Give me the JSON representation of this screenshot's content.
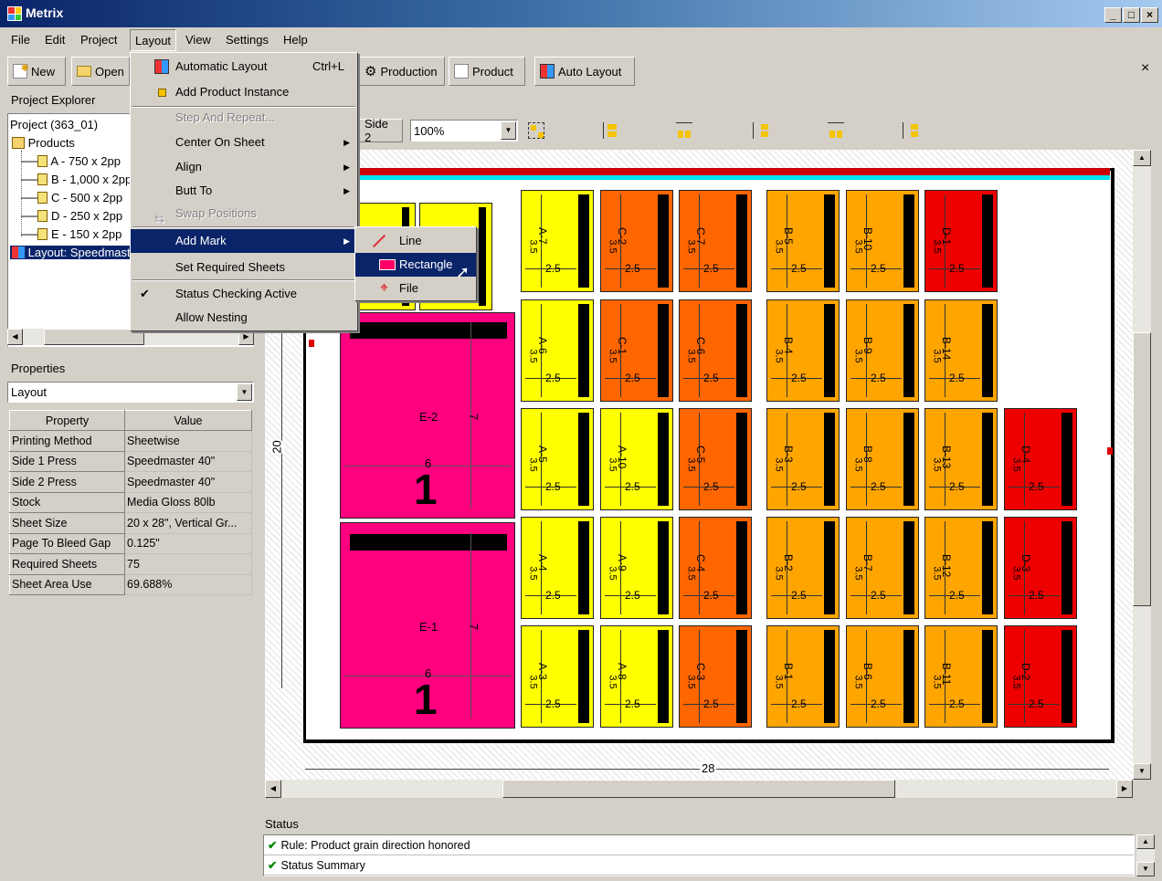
{
  "window": {
    "title": "Metrix",
    "minimize": "_",
    "maximize": "□",
    "close": "×"
  },
  "menubar": [
    "File",
    "Edit",
    "Project",
    "Layout",
    "View",
    "Settings",
    "Help"
  ],
  "toolbar": {
    "new": "New",
    "open": "Open",
    "production": "Production",
    "product": "Product",
    "auto_layout": "Auto Layout",
    "close": "×"
  },
  "project_explorer": {
    "title": "Project Explorer",
    "project": "Project  (363_01)",
    "products": "Products",
    "items": [
      "A - 750 x 2pp",
      "B - 1,000 x 2pp",
      "C - 500 x 2pp",
      "D - 250 x 2pp",
      "E - 150 x 2pp"
    ],
    "layout": "Layout: Speedmaster"
  },
  "properties": {
    "title": "Properties",
    "selector": "Layout",
    "col_property": "Property",
    "col_value": "Value",
    "rows": [
      {
        "k": "Printing Method",
        "v": "Sheetwise"
      },
      {
        "k": "Side 1 Press",
        "v": "Speedmaster 40\""
      },
      {
        "k": "Side 2 Press",
        "v": "Speedmaster 40\""
      },
      {
        "k": "Stock",
        "v": "Media Gloss 80lb"
      },
      {
        "k": "Sheet Size",
        "v": "20 x 28\", Vertical Gr..."
      },
      {
        "k": "Page To Bleed Gap",
        "v": "0.125\""
      },
      {
        "k": "Required Sheets",
        "v": "75"
      },
      {
        "k": "Sheet Area Use",
        "v": "69.688%"
      }
    ]
  },
  "layout_toolbar": {
    "side2": "Side 2",
    "zoom": "100%"
  },
  "layout_menu": {
    "items": [
      {
        "label": "Automatic Layout",
        "accel": "Ctrl+L"
      },
      {
        "label": "Add Product Instance"
      },
      {
        "label": "Step And Repeat..."
      },
      {
        "label": "Center On Sheet"
      },
      {
        "label": "Align"
      },
      {
        "label": "Butt To"
      },
      {
        "label": "Swap Positions"
      },
      {
        "label": "Add Mark"
      },
      {
        "label": "Set Required Sheets"
      },
      {
        "label": "Status Checking Active"
      },
      {
        "label": "Allow Nesting"
      }
    ]
  },
  "add_mark_menu": {
    "line": "Line",
    "rectangle": "Rectangle",
    "file": "File"
  },
  "sheet": {
    "width_label": "28",
    "height_label": "20"
  },
  "tiles": [
    {
      "id": "A-7",
      "color": "#ffff00"
    },
    {
      "id": "C-2",
      "color": "#ff6600"
    },
    {
      "id": "C-7",
      "color": "#ff6600"
    },
    {
      "id": "B-5",
      "color": "#ffa500"
    },
    {
      "id": "B-10",
      "color": "#ffa500"
    },
    {
      "id": "D-1",
      "color": "#ee0000"
    },
    {
      "id": "A-6",
      "color": "#ffff00"
    },
    {
      "id": "C-1",
      "color": "#ff6600"
    },
    {
      "id": "C-6",
      "color": "#ff6600"
    },
    {
      "id": "B-4",
      "color": "#ffa500"
    },
    {
      "id": "B-9",
      "color": "#ffa500"
    },
    {
      "id": "B-14",
      "color": "#ffa500"
    },
    {
      "id": "A-5",
      "color": "#ffff00"
    },
    {
      "id": "A-10",
      "color": "#ffff00"
    },
    {
      "id": "C-5",
      "color": "#ff6600"
    },
    {
      "id": "B-3",
      "color": "#ffa500"
    },
    {
      "id": "B-8",
      "color": "#ffa500"
    },
    {
      "id": "B-13",
      "color": "#ffa500"
    },
    {
      "id": "D-4",
      "color": "#ee0000"
    },
    {
      "id": "A-4",
      "color": "#ffff00"
    },
    {
      "id": "A-9",
      "color": "#ffff00"
    },
    {
      "id": "C-4",
      "color": "#ff6600"
    },
    {
      "id": "B-2",
      "color": "#ffa500"
    },
    {
      "id": "B-7",
      "color": "#ffa500"
    },
    {
      "id": "B-12",
      "color": "#ffa500"
    },
    {
      "id": "D-3",
      "color": "#ee0000"
    },
    {
      "id": "A-3",
      "color": "#ffff00"
    },
    {
      "id": "A-8",
      "color": "#ffff00"
    },
    {
      "id": "C-3",
      "color": "#ff6600"
    },
    {
      "id": "B-1",
      "color": "#ffa500"
    },
    {
      "id": "B-6",
      "color": "#ffa500"
    },
    {
      "id": "B-11",
      "color": "#ffa500"
    },
    {
      "id": "D-2",
      "color": "#ee0000"
    }
  ],
  "tile_dims": {
    "h": "3.5",
    "w": "2.5"
  },
  "big_tiles": [
    {
      "id": "E-2",
      "w": "6",
      "h": "7",
      "num": "1"
    },
    {
      "id": "E-1",
      "w": "6",
      "h": "7",
      "num": "1"
    }
  ],
  "status": {
    "title": "Status",
    "rows": [
      "Rule: Product grain direction honored",
      "Status Summary"
    ]
  }
}
